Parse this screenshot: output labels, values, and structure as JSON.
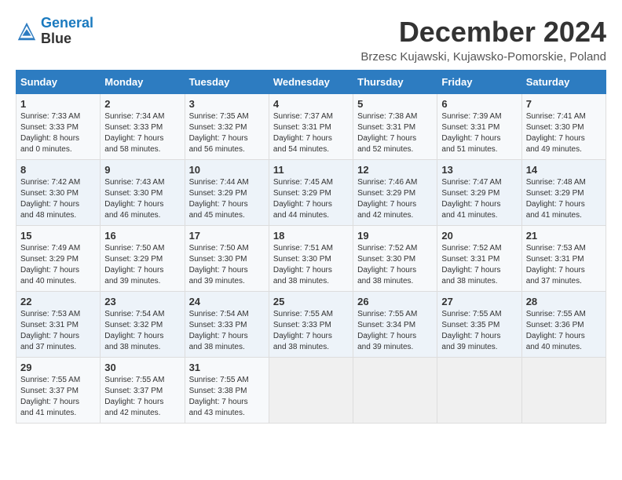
{
  "logo": {
    "line1": "General",
    "line2": "Blue"
  },
  "title": "December 2024",
  "subtitle": "Brzesc Kujawski, Kujawsko-Pomorskie, Poland",
  "weekdays": [
    "Sunday",
    "Monday",
    "Tuesday",
    "Wednesday",
    "Thursday",
    "Friday",
    "Saturday"
  ],
  "weeks": [
    [
      {
        "day": "1",
        "sunrise": "7:33 AM",
        "sunset": "3:33 PM",
        "daylight_hours": "8",
        "daylight_mins": "0"
      },
      {
        "day": "2",
        "sunrise": "7:34 AM",
        "sunset": "3:33 PM",
        "daylight_hours": "7",
        "daylight_mins": "58"
      },
      {
        "day": "3",
        "sunrise": "7:35 AM",
        "sunset": "3:32 PM",
        "daylight_hours": "7",
        "daylight_mins": "56"
      },
      {
        "day": "4",
        "sunrise": "7:37 AM",
        "sunset": "3:31 PM",
        "daylight_hours": "7",
        "daylight_mins": "54"
      },
      {
        "day": "5",
        "sunrise": "7:38 AM",
        "sunset": "3:31 PM",
        "daylight_hours": "7",
        "daylight_mins": "52"
      },
      {
        "day": "6",
        "sunrise": "7:39 AM",
        "sunset": "3:31 PM",
        "daylight_hours": "7",
        "daylight_mins": "51"
      },
      {
        "day": "7",
        "sunrise": "7:41 AM",
        "sunset": "3:30 PM",
        "daylight_hours": "7",
        "daylight_mins": "49"
      }
    ],
    [
      {
        "day": "8",
        "sunrise": "7:42 AM",
        "sunset": "3:30 PM",
        "daylight_hours": "7",
        "daylight_mins": "48"
      },
      {
        "day": "9",
        "sunrise": "7:43 AM",
        "sunset": "3:30 PM",
        "daylight_hours": "7",
        "daylight_mins": "46"
      },
      {
        "day": "10",
        "sunrise": "7:44 AM",
        "sunset": "3:29 PM",
        "daylight_hours": "7",
        "daylight_mins": "45"
      },
      {
        "day": "11",
        "sunrise": "7:45 AM",
        "sunset": "3:29 PM",
        "daylight_hours": "7",
        "daylight_mins": "44"
      },
      {
        "day": "12",
        "sunrise": "7:46 AM",
        "sunset": "3:29 PM",
        "daylight_hours": "7",
        "daylight_mins": "42"
      },
      {
        "day": "13",
        "sunrise": "7:47 AM",
        "sunset": "3:29 PM",
        "daylight_hours": "7",
        "daylight_mins": "41"
      },
      {
        "day": "14",
        "sunrise": "7:48 AM",
        "sunset": "3:29 PM",
        "daylight_hours": "7",
        "daylight_mins": "41"
      }
    ],
    [
      {
        "day": "15",
        "sunrise": "7:49 AM",
        "sunset": "3:29 PM",
        "daylight_hours": "7",
        "daylight_mins": "40"
      },
      {
        "day": "16",
        "sunrise": "7:50 AM",
        "sunset": "3:29 PM",
        "daylight_hours": "7",
        "daylight_mins": "39"
      },
      {
        "day": "17",
        "sunrise": "7:50 AM",
        "sunset": "3:30 PM",
        "daylight_hours": "7",
        "daylight_mins": "39"
      },
      {
        "day": "18",
        "sunrise": "7:51 AM",
        "sunset": "3:30 PM",
        "daylight_hours": "7",
        "daylight_mins": "38"
      },
      {
        "day": "19",
        "sunrise": "7:52 AM",
        "sunset": "3:30 PM",
        "daylight_hours": "7",
        "daylight_mins": "38"
      },
      {
        "day": "20",
        "sunrise": "7:52 AM",
        "sunset": "3:31 PM",
        "daylight_hours": "7",
        "daylight_mins": "38"
      },
      {
        "day": "21",
        "sunrise": "7:53 AM",
        "sunset": "3:31 PM",
        "daylight_hours": "7",
        "daylight_mins": "37"
      }
    ],
    [
      {
        "day": "22",
        "sunrise": "7:53 AM",
        "sunset": "3:31 PM",
        "daylight_hours": "7",
        "daylight_mins": "37"
      },
      {
        "day": "23",
        "sunrise": "7:54 AM",
        "sunset": "3:32 PM",
        "daylight_hours": "7",
        "daylight_mins": "38"
      },
      {
        "day": "24",
        "sunrise": "7:54 AM",
        "sunset": "3:33 PM",
        "daylight_hours": "7",
        "daylight_mins": "38"
      },
      {
        "day": "25",
        "sunrise": "7:55 AM",
        "sunset": "3:33 PM",
        "daylight_hours": "7",
        "daylight_mins": "38"
      },
      {
        "day": "26",
        "sunrise": "7:55 AM",
        "sunset": "3:34 PM",
        "daylight_hours": "7",
        "daylight_mins": "39"
      },
      {
        "day": "27",
        "sunrise": "7:55 AM",
        "sunset": "3:35 PM",
        "daylight_hours": "7",
        "daylight_mins": "39"
      },
      {
        "day": "28",
        "sunrise": "7:55 AM",
        "sunset": "3:36 PM",
        "daylight_hours": "7",
        "daylight_mins": "40"
      }
    ],
    [
      {
        "day": "29",
        "sunrise": "7:55 AM",
        "sunset": "3:37 PM",
        "daylight_hours": "7",
        "daylight_mins": "41"
      },
      {
        "day": "30",
        "sunrise": "7:55 AM",
        "sunset": "3:37 PM",
        "daylight_hours": "7",
        "daylight_mins": "42"
      },
      {
        "day": "31",
        "sunrise": "7:55 AM",
        "sunset": "3:38 PM",
        "daylight_hours": "7",
        "daylight_mins": "43"
      },
      null,
      null,
      null,
      null
    ]
  ]
}
